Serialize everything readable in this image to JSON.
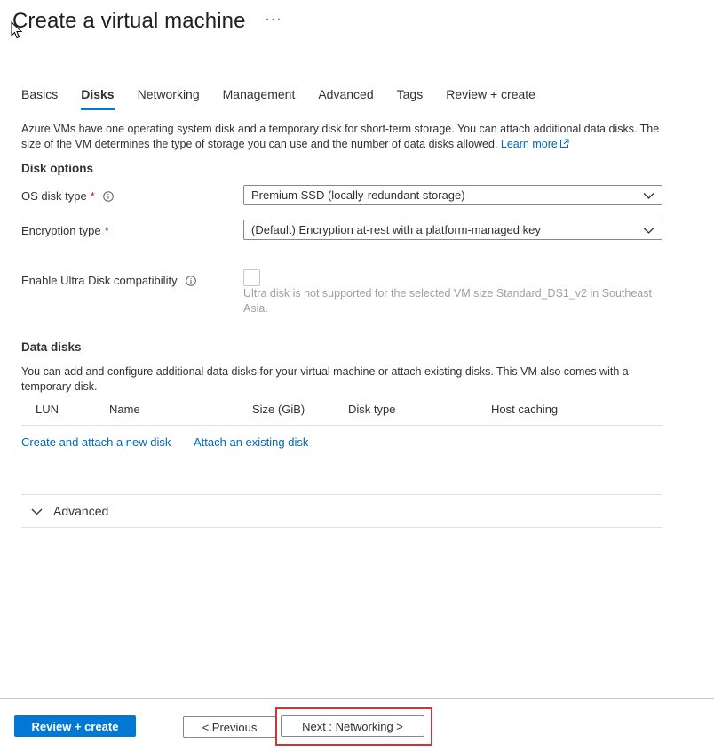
{
  "header": {
    "title": "Create a virtual machine",
    "more_label": "···"
  },
  "tabs": [
    {
      "label": "Basics",
      "active": false
    },
    {
      "label": "Disks",
      "active": true
    },
    {
      "label": "Networking",
      "active": false
    },
    {
      "label": "Management",
      "active": false
    },
    {
      "label": "Advanced",
      "active": false
    },
    {
      "label": "Tags",
      "active": false
    },
    {
      "label": "Review + create",
      "active": false
    }
  ],
  "intro": {
    "text": "Azure VMs have one operating system disk and a temporary disk for short-term storage. You can attach additional data disks. The size of the VM determines the type of storage you can use and the number of data disks allowed.",
    "learn_more": "Learn more"
  },
  "disk_options": {
    "title": "Disk options",
    "os_disk_type": {
      "label": "OS disk type",
      "required": "*",
      "value": "Premium SSD (locally-redundant storage)"
    },
    "encryption_type": {
      "label": "Encryption type",
      "required": "*",
      "value": "(Default) Encryption at-rest with a platform-managed key"
    },
    "ultra_disk": {
      "label": "Enable Ultra Disk compatibility",
      "checked": false,
      "note": "Ultra disk is not supported for the selected VM size Standard_DS1_v2 in Southeast Asia."
    }
  },
  "data_disks": {
    "title": "Data disks",
    "intro": "You can add and configure additional data disks for your virtual machine or attach existing disks. This VM also comes with a temporary disk.",
    "columns": [
      "LUN",
      "Name",
      "Size (GiB)",
      "Disk type",
      "Host caching"
    ],
    "create_link": "Create and attach a new disk",
    "attach_link": "Attach an existing disk"
  },
  "advanced_section": {
    "label": "Advanced"
  },
  "footer": {
    "review_create": "Review + create",
    "previous": "< Previous",
    "next": "Next : Networking >"
  },
  "colors": {
    "accent": "#0078d4",
    "link": "#0067b8",
    "required": "#a4262c",
    "highlight": "#d13438"
  }
}
